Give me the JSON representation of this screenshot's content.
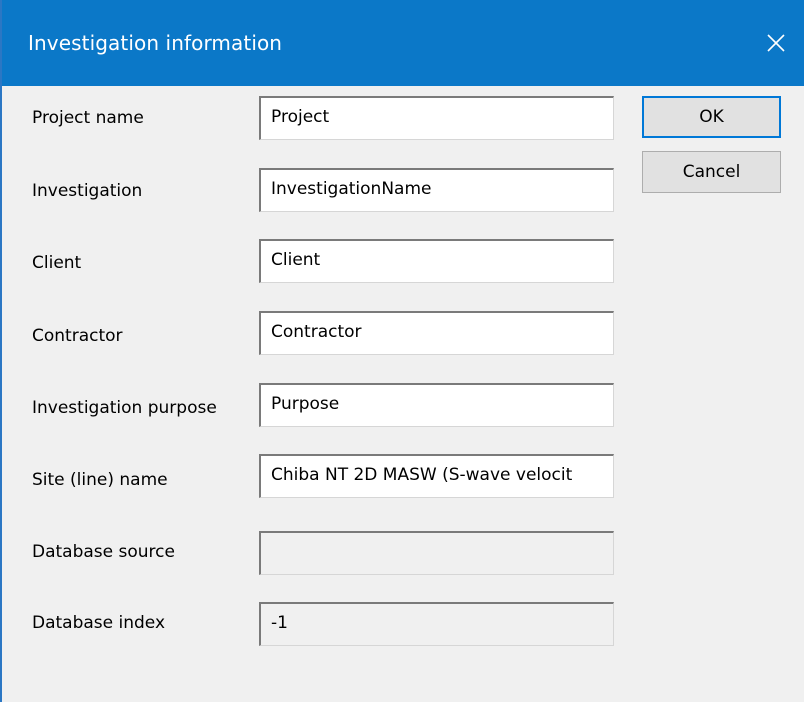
{
  "window": {
    "title": "Investigation information"
  },
  "fields": [
    {
      "label": "Project name",
      "value": "Project"
    },
    {
      "label": "Investigation",
      "value": "InvestigationName"
    },
    {
      "label": "Client",
      "value": "Client"
    },
    {
      "label": "Contractor",
      "value": "Contractor"
    },
    {
      "label": "Investigation purpose",
      "value": "Purpose"
    },
    {
      "label": "Site (line) name",
      "value": "Chiba NT 2D MASW (S-wave velocit"
    },
    {
      "label": "Database source",
      "value": ""
    },
    {
      "label": "Database index",
      "value": "-1"
    }
  ],
  "buttons": {
    "ok": "OK",
    "cancel": "Cancel"
  },
  "colors": {
    "titlebar": "#0b78c8",
    "dialog_bg": "#f0f0f0",
    "default_button_border": "#0078d7"
  },
  "icons": {
    "close": "close-icon"
  }
}
